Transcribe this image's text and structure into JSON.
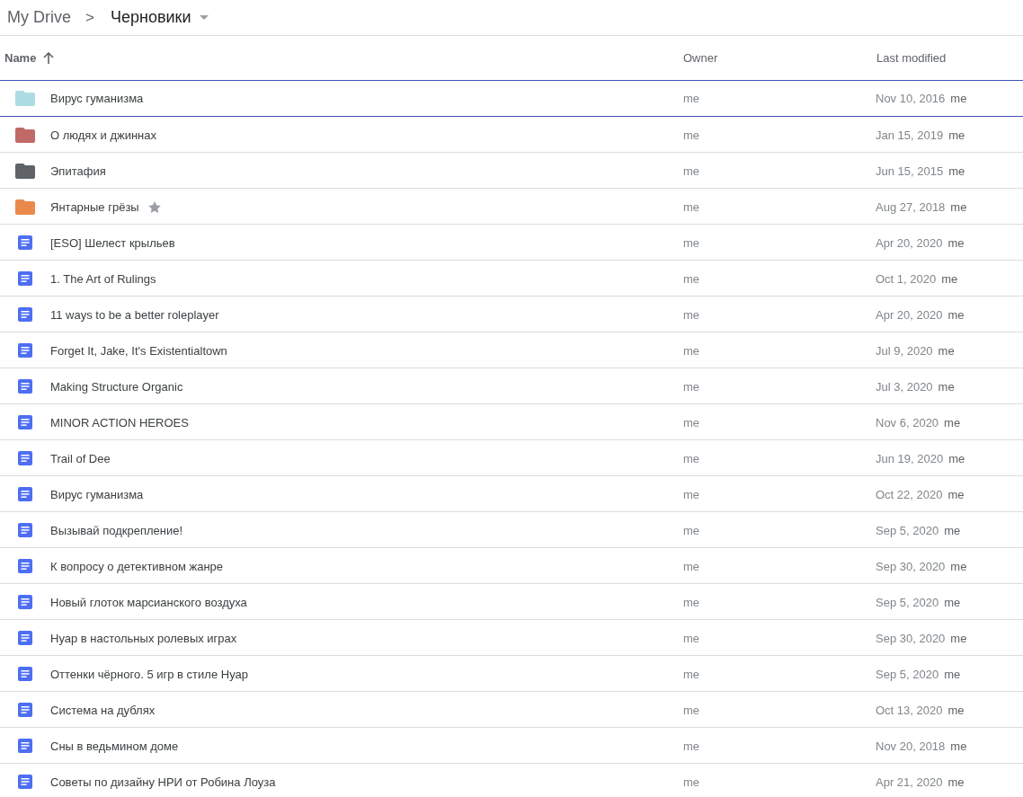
{
  "breadcrumb": {
    "root": "My Drive",
    "separator": ">",
    "current": "Черновики"
  },
  "columns": [
    {
      "label": "Name",
      "sorted": true
    },
    {
      "label": "Owner",
      "sorted": false
    },
    {
      "label": "Last modified",
      "sorted": false
    }
  ],
  "rows": [
    {
      "kind": "folder",
      "color": "#aedce4",
      "name": "Вирус гуманизма",
      "starred": false,
      "owner": "me",
      "modified": "Nov 10, 2016",
      "modified_by": "me",
      "selected": true
    },
    {
      "kind": "folder",
      "color": "#c06a67",
      "name": "О людях и джиннах",
      "starred": false,
      "owner": "me",
      "modified": "Jan 15, 2019",
      "modified_by": "me",
      "selected": false
    },
    {
      "kind": "folder",
      "color": "#5f6368",
      "name": "Эпитафия",
      "starred": false,
      "owner": "me",
      "modified": "Jun 15, 2015",
      "modified_by": "me",
      "selected": false
    },
    {
      "kind": "folder",
      "color": "#e98a4c",
      "name": "Янтарные грёзы",
      "starred": true,
      "owner": "me",
      "modified": "Aug 27, 2018",
      "modified_by": "me",
      "selected": false
    },
    {
      "kind": "doc",
      "name": "[ESO] Шелест крыльев",
      "starred": false,
      "owner": "me",
      "modified": "Apr 20, 2020",
      "modified_by": "me",
      "selected": false
    },
    {
      "kind": "doc",
      "name": "1. The Art of Rulings",
      "starred": false,
      "owner": "me",
      "modified": "Oct 1, 2020",
      "modified_by": "me",
      "selected": false
    },
    {
      "kind": "doc",
      "name": "11 ways to be a better roleplayer",
      "starred": false,
      "owner": "me",
      "modified": "Apr 20, 2020",
      "modified_by": "me",
      "selected": false
    },
    {
      "kind": "doc",
      "name": "Forget It, Jake, It's Existentialtown",
      "starred": false,
      "owner": "me",
      "modified": "Jul 9, 2020",
      "modified_by": "me",
      "selected": false
    },
    {
      "kind": "doc",
      "name": "Making Structure Organic",
      "starred": false,
      "owner": "me",
      "modified": "Jul 3, 2020",
      "modified_by": "me",
      "selected": false
    },
    {
      "kind": "doc",
      "name": "MINOR ACTION HEROES",
      "starred": false,
      "owner": "me",
      "modified": "Nov 6, 2020",
      "modified_by": "me",
      "selected": false
    },
    {
      "kind": "doc",
      "name": "Trail of Dee",
      "starred": false,
      "owner": "me",
      "modified": "Jun 19, 2020",
      "modified_by": "me",
      "selected": false
    },
    {
      "kind": "doc",
      "name": "Вирус гуманизма",
      "starred": false,
      "owner": "me",
      "modified": "Oct 22, 2020",
      "modified_by": "me",
      "selected": false
    },
    {
      "kind": "doc",
      "name": "Вызывай подкрепление!",
      "starred": false,
      "owner": "me",
      "modified": "Sep 5, 2020",
      "modified_by": "me",
      "selected": false
    },
    {
      "kind": "doc",
      "name": "К вопросу о детективном жанре",
      "starred": false,
      "owner": "me",
      "modified": "Sep 30, 2020",
      "modified_by": "me",
      "selected": false
    },
    {
      "kind": "doc",
      "name": "Новый глоток марсианского воздуха",
      "starred": false,
      "owner": "me",
      "modified": "Sep 5, 2020",
      "modified_by": "me",
      "selected": false
    },
    {
      "kind": "doc",
      "name": "Нуар в настольных ролевых играх",
      "starred": false,
      "owner": "me",
      "modified": "Sep 30, 2020",
      "modified_by": "me",
      "selected": false
    },
    {
      "kind": "doc",
      "name": "Оттенки чёрного. 5 игр в стиле Нуар",
      "starred": false,
      "owner": "me",
      "modified": "Sep 5, 2020",
      "modified_by": "me",
      "selected": false
    },
    {
      "kind": "doc",
      "name": "Система на дублях",
      "starred": false,
      "owner": "me",
      "modified": "Oct 13, 2020",
      "modified_by": "me",
      "selected": false
    },
    {
      "kind": "doc",
      "name": "Сны в ведьмином доме",
      "starred": false,
      "owner": "me",
      "modified": "Nov 20, 2018",
      "modified_by": "me",
      "selected": false
    },
    {
      "kind": "doc",
      "name": "Советы по дизайну НРИ от Робина Лоуза",
      "starred": false,
      "owner": "me",
      "modified": "Apr 21, 2020",
      "modified_by": "me",
      "selected": false
    }
  ]
}
